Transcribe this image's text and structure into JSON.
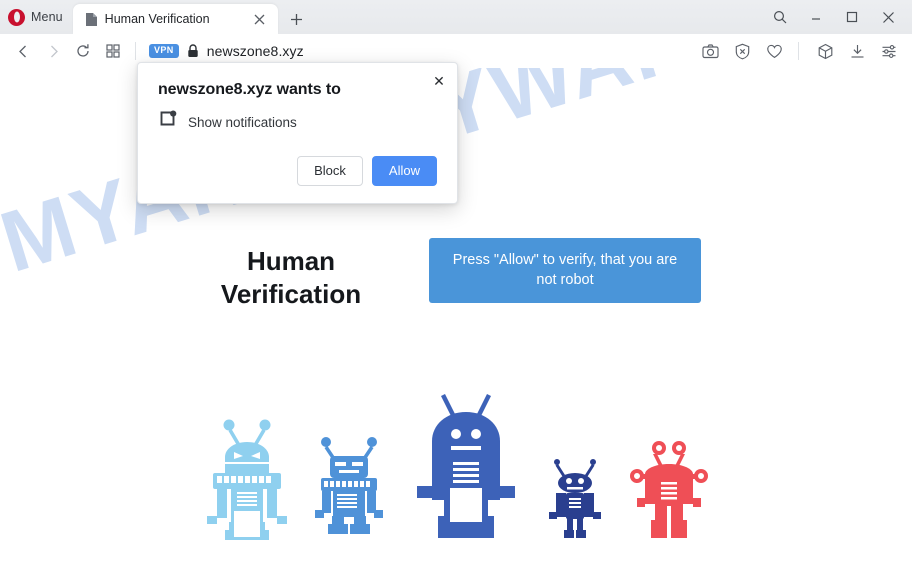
{
  "window": {
    "menu_label": "Menu",
    "controls": [
      {
        "name": "search",
        "glyph": "search-icon"
      },
      {
        "name": "minimize",
        "glyph": "minimize-icon"
      },
      {
        "name": "maximize",
        "glyph": "maximize-icon"
      },
      {
        "name": "close",
        "glyph": "close-icon"
      }
    ]
  },
  "tabs": [
    {
      "title": "Human Verification",
      "favicon": "page-icon",
      "active": true
    }
  ],
  "newtab_label": "+",
  "toolbar": {
    "back": "back-icon",
    "forward": "forward-icon",
    "reload": "reload-icon",
    "tab_grid": "tab-grid-icon",
    "vpn_badge": "VPN",
    "lock": "lock-icon",
    "url": "newszone8.xyz",
    "right_icons": [
      {
        "name": "snapshot-icon"
      },
      {
        "name": "ad-blocker-icon"
      },
      {
        "name": "heart-icon"
      },
      {
        "name": "cube-icon"
      },
      {
        "name": "download-icon"
      },
      {
        "name": "easy-setup-icon"
      }
    ]
  },
  "dialog": {
    "title": "newszone8.xyz wants to",
    "permission_icon": "notification-permission-icon",
    "permission_label": "Show notifications",
    "block_label": "Block",
    "allow_label": "Allow",
    "close_label": "✕"
  },
  "page": {
    "watermark": "MYANTISPYWARE.COM",
    "heading_line1": "Human",
    "heading_line2": "Verification",
    "banner_text": "Press \"Allow\" to verify, that you are not robot",
    "robots": [
      {
        "name": "robot-light-blue",
        "color": "#8fd0ef",
        "height": 118
      },
      {
        "name": "robot-medium-blue",
        "color": "#4f92d8",
        "height": 100
      },
      {
        "name": "robot-large-royal-blue",
        "color": "#3d62b8",
        "height": 148
      },
      {
        "name": "robot-small-navy",
        "color": "#2a3f8f",
        "height": 80
      },
      {
        "name": "robot-red",
        "color": "#ef4f56",
        "height": 96
      }
    ]
  },
  "colors": {
    "accent_blue": "#4a8cf5",
    "banner_blue": "#4a95d9",
    "vpn_blue": "#4a90e2",
    "opera_red": "#c8102e",
    "watermark_blue": "#ccdcf4"
  }
}
